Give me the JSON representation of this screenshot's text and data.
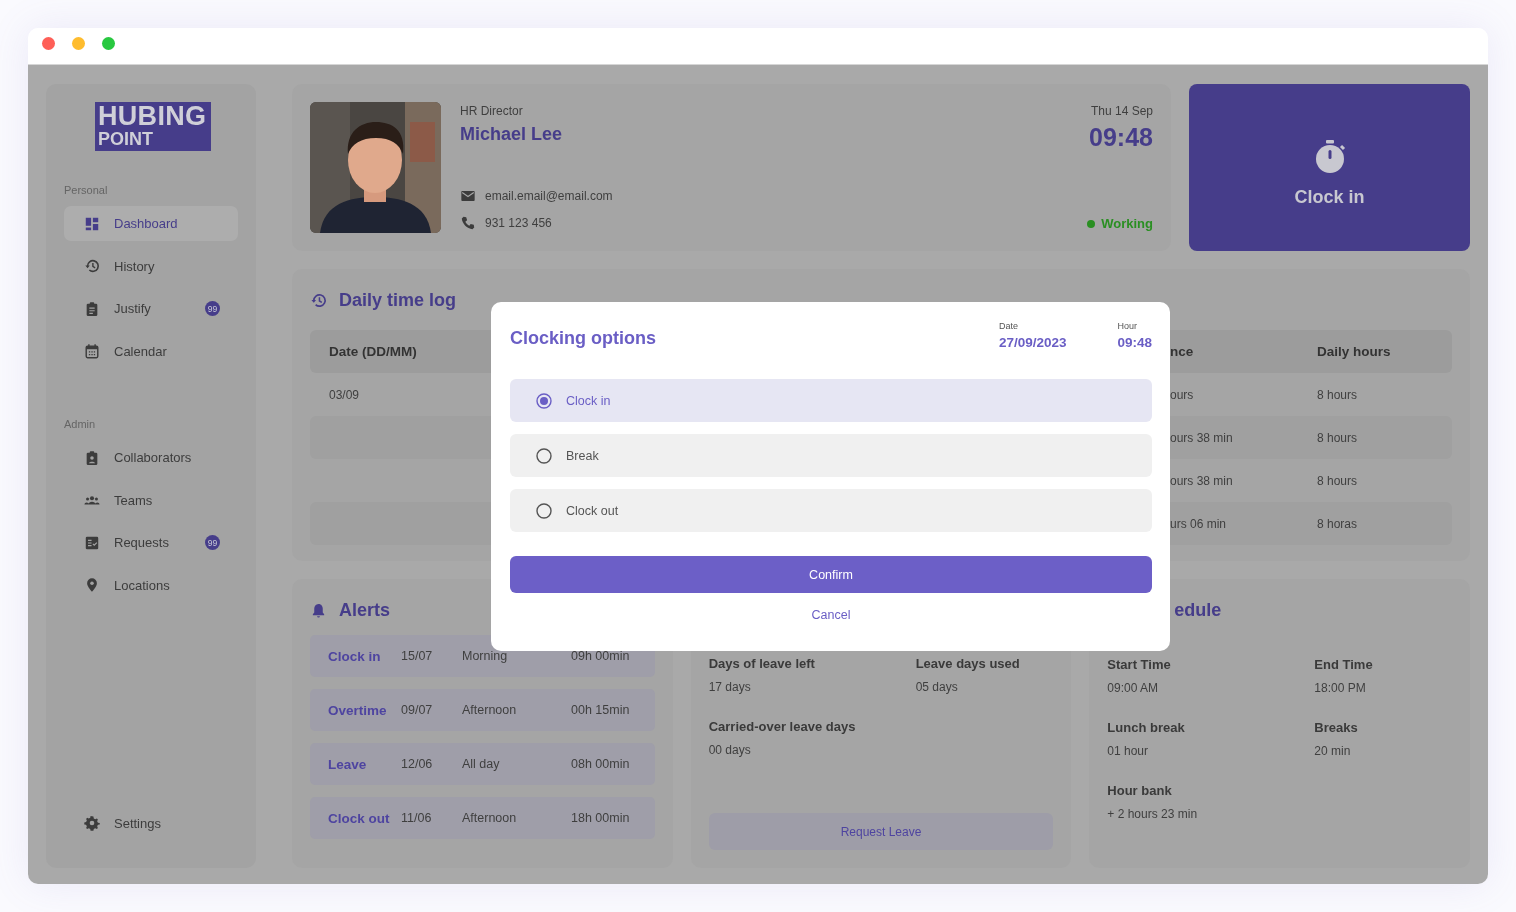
{
  "window": {
    "controls": [
      {
        "color": "#fe5f57"
      },
      {
        "color": "#febc2e"
      },
      {
        "color": "#28c840"
      }
    ]
  },
  "sidebar": {
    "logo": {
      "line1": "HUBING",
      "line2": "POINT"
    },
    "sections": [
      {
        "heading": "Personal",
        "items": [
          {
            "label": "Dashboard",
            "selected": true
          },
          {
            "label": "History",
            "selected": false
          },
          {
            "label": "Justify",
            "selected": false,
            "badge": "99"
          },
          {
            "label": "Calendar",
            "selected": false
          }
        ]
      },
      {
        "heading": "Admin",
        "items": [
          {
            "label": "Collaborators",
            "selected": false
          },
          {
            "label": "Teams",
            "selected": false
          },
          {
            "label": "Requests",
            "selected": false,
            "badge": "99"
          },
          {
            "label": "Locations",
            "selected": false
          }
        ]
      }
    ],
    "footer_item": {
      "label": "Settings",
      "selected": false
    }
  },
  "profile": {
    "role": "HR Director",
    "name": "Michael Lee",
    "email": "email.email@email.com",
    "phone": "931 123 456",
    "date": "Thu 14 Sep",
    "time": "09:48",
    "status": "Working"
  },
  "clock_card": {
    "label": "Clock in"
  },
  "daily_log": {
    "title": "Daily time log",
    "columns": [
      {
        "label": "Date (DD/MM)"
      },
      {
        "label": "nce"
      },
      {
        "label": "Daily hours"
      }
    ],
    "rows": [
      {
        "date": "03/09",
        "column_3": "ours",
        "daily_hours": "8 hours"
      },
      {
        "column_3": "ours 38 min",
        "daily_hours": "8 hours"
      },
      {
        "column_3": "ours 38 min",
        "daily_hours": "8 hours"
      },
      {
        "column_3": "urs 06 min",
        "daily_hours": "8 horas"
      }
    ]
  },
  "alerts": {
    "title": "Alerts",
    "items": [
      {
        "type": "Clock in",
        "date": "15/07",
        "period": "Morning",
        "duration": "09h 00min"
      },
      {
        "type": "Overtime",
        "date": "09/07",
        "period": "Afternoon",
        "duration": "00h 15min"
      },
      {
        "type": "Leave",
        "date": "12/06",
        "period": "All day",
        "duration": "08h 00min"
      },
      {
        "type": "Clock out",
        "date": "11/06",
        "period": "Afternoon",
        "duration": "18h 00min"
      }
    ]
  },
  "leave": {
    "fields": [
      {
        "label": "Days of leave left",
        "value": "17 days"
      },
      {
        "label": "Leave days used",
        "value": "05 days"
      },
      {
        "label": "Carried-over leave days",
        "value": "00 days"
      }
    ],
    "button": "Request Leave"
  },
  "schedule": {
    "title": "edule",
    "fields": [
      {
        "label": "Start Time",
        "value": "09:00 AM"
      },
      {
        "label": "End Time",
        "value": "18:00 PM"
      },
      {
        "label": "Lunch break",
        "value": "01 hour"
      },
      {
        "label": "Breaks",
        "value": "20 min"
      },
      {
        "label": "Hour bank",
        "value": "+ 2 hours 23 min"
      }
    ]
  },
  "modal": {
    "title": "Clocking options",
    "date_label": "Date",
    "date": "27/09/2023",
    "hour_label": "Hour",
    "hour": "09:48",
    "options": [
      {
        "label": "Clock in",
        "selected": true
      },
      {
        "label": "Break",
        "selected": false
      },
      {
        "label": "Clock out",
        "selected": false
      }
    ],
    "confirm": "Confirm",
    "cancel": "Cancel"
  }
}
